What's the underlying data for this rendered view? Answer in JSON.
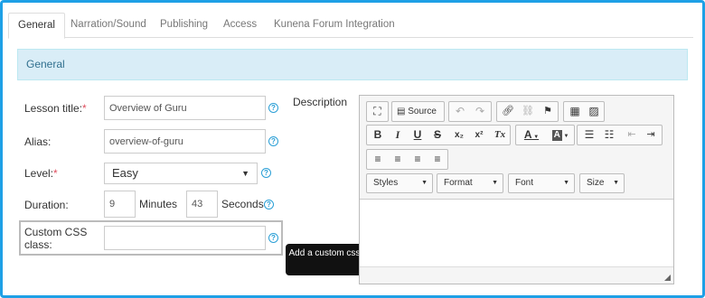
{
  "tabs": [
    {
      "label": "General",
      "active": true
    },
    {
      "label": "Narration/Sound",
      "active": false
    },
    {
      "label": "Publishing",
      "active": false
    },
    {
      "label": "Access",
      "active": false
    },
    {
      "label": "Kunena Forum Integration",
      "active": false
    }
  ],
  "section_title": "General",
  "form": {
    "lesson_title_label": "Lesson title:",
    "lesson_title_required": "*",
    "lesson_title_value": "Overview of Guru",
    "alias_label": "Alias:",
    "alias_value": "overview-of-guru",
    "level_label": "Level:",
    "level_required": "*",
    "level_value": "Easy",
    "duration_label": "Duration:",
    "duration_minutes_value": "9",
    "minutes_label": "Minutes",
    "duration_seconds_value": "43",
    "seconds_label": "Seconds",
    "custom_css_label": "Custom CSS class:",
    "custom_css_value": "",
    "help_glyph": "?"
  },
  "tooltip": "Add a custom css class for this lesson",
  "description_label": "Description",
  "editor": {
    "source_label": "Source",
    "styles_label": "Styles",
    "format_label": "Format",
    "font_label": "Font",
    "size_label": "Size",
    "bold": "B",
    "italic": "I",
    "underline": "U",
    "strike": "S",
    "subscript": "x₂",
    "superscript": "x²",
    "remove_format": "Tx",
    "text_color": "A",
    "bg_color": "A"
  },
  "colors": {
    "frame": "#1ea0e6",
    "section_bg": "#d9edf7",
    "section_text": "#31708f",
    "required": "#e04f5f",
    "help": "#2a9fd6",
    "tooltip_bg": "#111111"
  }
}
